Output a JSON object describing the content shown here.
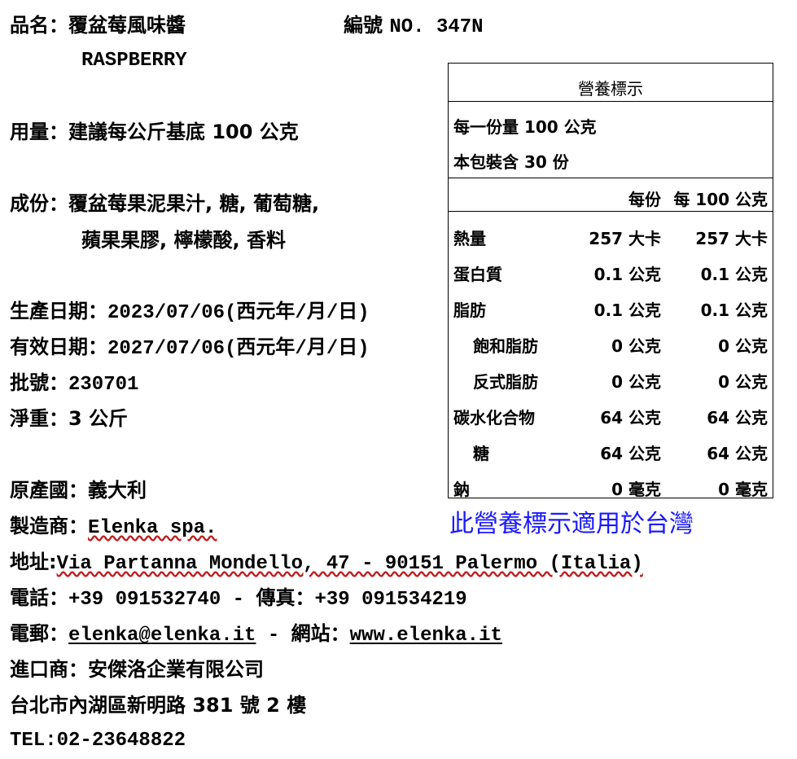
{
  "product": {
    "name_label": "品名：",
    "name_value": "覆盆莓風味醬",
    "name_en": "RASPBERRY",
    "code_label": "編號",
    "code_value": "NO. 347N"
  },
  "usage": {
    "label": "用量：",
    "value": "建議每公斤基底 100 公克"
  },
  "ingredients": {
    "label": "成份：",
    "line1": "覆盆莓果泥果汁, 糖, 葡萄糖,",
    "line2": "蘋果果膠, 檸檬酸, 香料"
  },
  "dates": {
    "mfg_label": "生產日期：",
    "mfg_value": "2023/07/06(西元年/月/日)",
    "exp_label": "有效日期：",
    "exp_value": "2027/07/06(西元年/月/日)",
    "batch_label": "批號：",
    "batch_value": "230701",
    "weight_label": "淨重：",
    "weight_value": "3 公斤"
  },
  "origin": {
    "label": "原產國：",
    "value": "義大利"
  },
  "maker": {
    "label": "製造商：",
    "value": "Elenka spa."
  },
  "address": {
    "label": "地址:",
    "value": "Via Partanna Mondello, 47 - 90151 Palermo (Italia)"
  },
  "phone": {
    "label": "電話：",
    "value": "+39 091532740",
    "sep": " - ",
    "fax_label": "傳真：",
    "fax_value": "+39 091534219"
  },
  "email": {
    "label": "電郵：",
    "value": "elenka@elenka.it",
    "sep": " - ",
    "web_label": "網站：",
    "web_value": "www.elenka.it"
  },
  "importer": {
    "label": "進口商：",
    "value": "安傑洛企業有限公司",
    "address": "台北市內湖區新明路 381 號 2 樓",
    "tel": "TEL:02-23648822"
  },
  "nutrition": {
    "title": "營養標示",
    "serving_size": "每一份量 100 公克",
    "servings": "本包裝含 30 份",
    "col_per_serving": "每份",
    "col_per_100": "每 100 公克",
    "rows": [
      {
        "name": "熱量",
        "per": "257 大卡",
        "per100": "257 大卡"
      },
      {
        "name": "蛋白質",
        "per": "0.1 公克",
        "per100": "0.1 公克"
      },
      {
        "name": "脂肪",
        "per": "0.1 公克",
        "per100": "0.1 公克"
      },
      {
        "name": "飽和脂肪",
        "per": "0 公克",
        "per100": "0 公克"
      },
      {
        "name": "反式脂肪",
        "per": "0 公克",
        "per100": "0 公克"
      },
      {
        "name": "碳水化合物",
        "per": "64 公克",
        "per100": "64 公克"
      },
      {
        "name": "糖",
        "per": "64 公克",
        "per100": "64 公克"
      },
      {
        "name": "鈉",
        "per": "0 毫克",
        "per100": "0 毫克"
      }
    ],
    "taiwan_note": "此營養標示適用於台灣"
  }
}
